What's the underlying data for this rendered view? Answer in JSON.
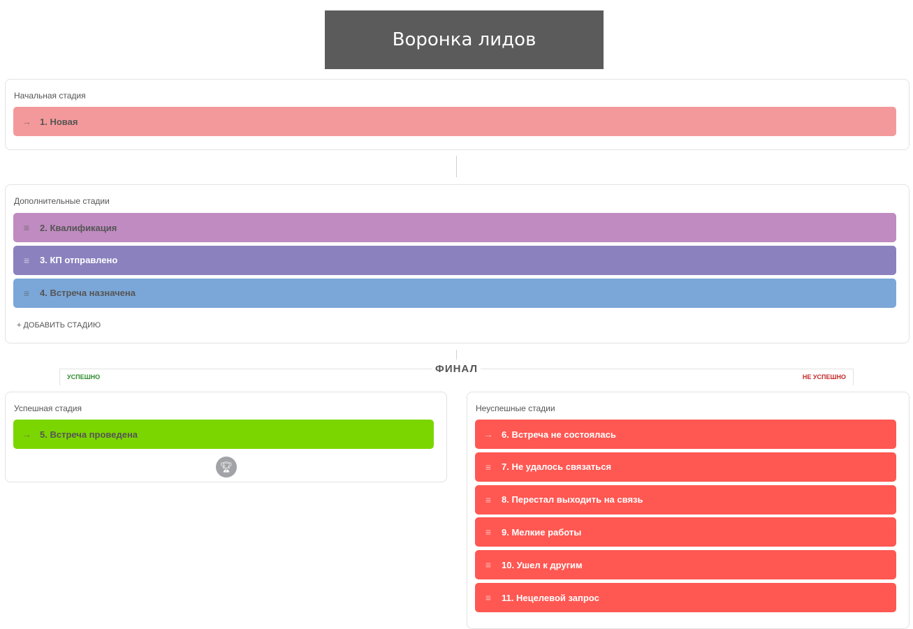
{
  "title": "Воронка лидов",
  "initial": {
    "label": "Начальная стадия",
    "items": [
      {
        "text": "1. Новая",
        "icon": "arrow-right-icon",
        "color": "#f4999b",
        "text_color": "#555555"
      }
    ]
  },
  "additional": {
    "label": "Дополнительные стадии",
    "items": [
      {
        "text": "2. Квалификация",
        "icon": "drag-handle-icon",
        "color": "#bf8bc0",
        "text_color": "#555555"
      },
      {
        "text": "3. КП отправлено",
        "icon": "drag-handle-icon",
        "color": "#8a81be",
        "text_color": "#ffffff"
      },
      {
        "text": "4. Встреча назначена",
        "icon": "drag-handle-icon",
        "color": "#7ba7d8",
        "text_color": "#555555"
      }
    ],
    "add_label": "+ ДОБАВИТЬ СТАДИЮ"
  },
  "final": {
    "label": "ФИНАЛ",
    "success_tab": "УСПЕШНО",
    "fail_tab": "НЕ УСПЕШНО",
    "success_color": "#2e8b2e",
    "fail_color": "#c62828"
  },
  "success": {
    "label": "Успешная стадия",
    "items": [
      {
        "text": "5. Встреча проведена",
        "icon": "arrow-right-icon",
        "color": "#7bd600",
        "text_color": "#555555"
      }
    ]
  },
  "fail": {
    "label": "Неуспешные стадии",
    "items": [
      {
        "text": "6. Встреча не состоялась",
        "icon": "arrow-right-icon",
        "color": "#ff5752",
        "text_color": "#ffffff"
      },
      {
        "text": "7. Не удалось связаться",
        "icon": "drag-handle-icon",
        "color": "#ff5752",
        "text_color": "#ffffff"
      },
      {
        "text": "8. Перестал выходить на связь",
        "icon": "drag-handle-icon",
        "color": "#ff5752",
        "text_color": "#ffffff"
      },
      {
        "text": "9. Мелкие работы",
        "icon": "drag-handle-icon",
        "color": "#ff5752",
        "text_color": "#ffffff"
      },
      {
        "text": "10. Ушел к другим",
        "icon": "drag-handle-icon",
        "color": "#ff5752",
        "text_color": "#ffffff"
      },
      {
        "text": "11. Нецелевой запрос",
        "icon": "drag-handle-icon",
        "color": "#ff5752",
        "text_color": "#ffffff"
      }
    ]
  }
}
